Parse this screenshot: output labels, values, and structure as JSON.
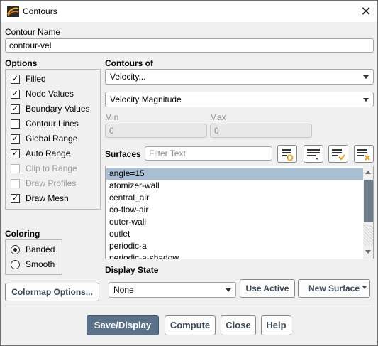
{
  "window": {
    "title": "Contours"
  },
  "contour_name": {
    "label": "Contour Name",
    "value": "contour-vel"
  },
  "options": {
    "heading": "Options",
    "items": [
      {
        "label": "Filled",
        "checked": true,
        "enabled": true
      },
      {
        "label": "Node Values",
        "checked": true,
        "enabled": true
      },
      {
        "label": "Boundary Values",
        "checked": true,
        "enabled": true
      },
      {
        "label": "Contour Lines",
        "checked": false,
        "enabled": true
      },
      {
        "label": "Global Range",
        "checked": true,
        "enabled": true
      },
      {
        "label": "Auto Range",
        "checked": true,
        "enabled": true
      },
      {
        "label": "Clip to Range",
        "checked": false,
        "enabled": false
      },
      {
        "label": "Draw Profiles",
        "checked": false,
        "enabled": false
      },
      {
        "label": "Draw Mesh",
        "checked": true,
        "enabled": true
      }
    ]
  },
  "contours_of": {
    "label": "Contours of",
    "primary": "Velocity...",
    "secondary": "Velocity Magnitude"
  },
  "range": {
    "min_label": "Min",
    "min_value": "0",
    "max_label": "Max",
    "max_value": "0"
  },
  "surfaces": {
    "label": "Surfaces",
    "filter_placeholder": "Filter Text",
    "items": [
      "angle=15",
      "atomizer-wall",
      "central_air",
      "co-flow-air",
      "outer-wall",
      "outlet",
      "periodic-a",
      "periodic-a-shadow"
    ],
    "selected": "angle=15"
  },
  "coloring": {
    "heading": "Coloring",
    "options": [
      {
        "label": "Banded",
        "selected": true
      },
      {
        "label": "Smooth",
        "selected": false
      }
    ]
  },
  "display_state": {
    "label": "Display State",
    "value": "None",
    "use_active": "Use Active",
    "new_surface": "New Surface"
  },
  "buttons": {
    "colormap": "Colormap Options...",
    "save_display": "Save/Display",
    "compute": "Compute",
    "close": "Close",
    "help": "Help"
  },
  "colors": {
    "accent": "#5a7188",
    "selection": "#a9bdd3",
    "scroll_thumb": "#6e7b89"
  },
  "icons": [
    "app-icon",
    "close-icon",
    "surface-select-icon",
    "surface-group-icon",
    "surface-check-icon",
    "surface-clear-icon"
  ]
}
